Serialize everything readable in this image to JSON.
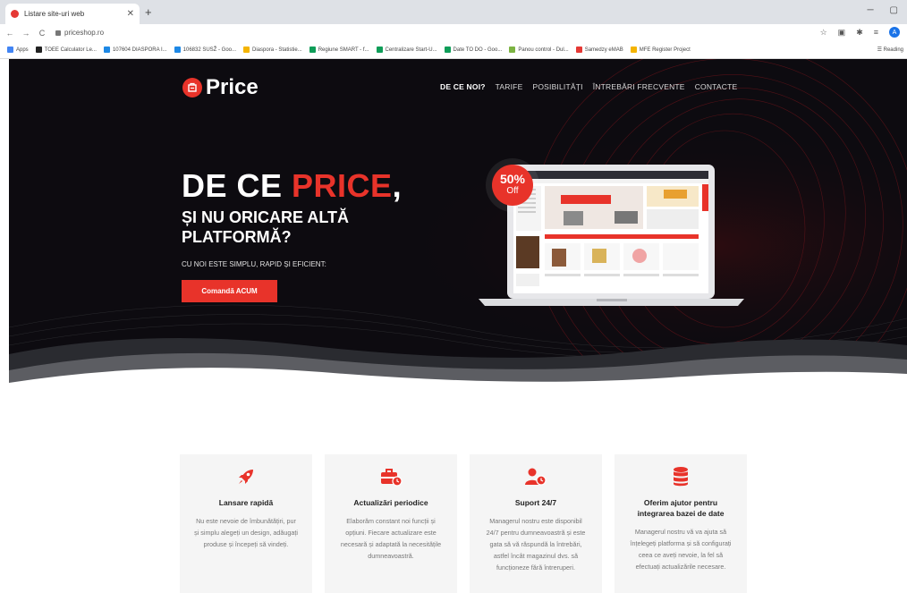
{
  "browser": {
    "tab_title": "Listare site-uri web",
    "url": "priceshop.ro",
    "profile_initial": "A",
    "bookmarks": [
      {
        "label": "Apps",
        "color": "#4285f4"
      },
      {
        "label": "TOEE Calculator Le...",
        "color": "#222222"
      },
      {
        "label": "107604 DIASPORA I...",
        "color": "#1e88e5"
      },
      {
        "label": "106832 SUSŽ - Goo...",
        "color": "#1e88e5"
      },
      {
        "label": "Diaspora - Statistie...",
        "color": "#f4b400"
      },
      {
        "label": "Regiune SMART - f...",
        "color": "#0f9d58"
      },
      {
        "label": "Centralizare Start-U...",
        "color": "#0f9d58"
      },
      {
        "label": "Date TO DO - Goo...",
        "color": "#0f9d58"
      },
      {
        "label": "Panou control - Dul...",
        "color": "#7cb342"
      },
      {
        "label": "Samedzy eMAB",
        "color": "#e53935"
      },
      {
        "label": "MFE Register Project",
        "color": "#f4b400"
      }
    ],
    "reading_list": "Reading"
  },
  "site": {
    "logo_text": "Price",
    "menu": [
      "DE CE NOI?",
      "TARIFE",
      "POSIBILITĂȚI",
      "ÎNTREBĂRI FRECVENTE",
      "CONTACTE"
    ],
    "hero": {
      "title_white": "DE CE ",
      "title_red": "PRICE",
      "title_comma": ",",
      "subtitle": "ȘI NU ORICARE ALTĂ PLATFORMĂ?",
      "tagline": "CU NOI ESTE SIMPLU, RAPID ȘI EFICIENT:",
      "cta": "Comandă ACUM",
      "badge_percent": "50%",
      "badge_off": "Off"
    },
    "features": [
      {
        "icon": "rocket-icon",
        "title": "Lansare rapidă",
        "text": "Nu este nevoie de îmbunătățiri, pur și simplu alegeți un design, adăugați produse și începeți să vindeți."
      },
      {
        "icon": "toolbox-icon",
        "title": "Actualizări periodice",
        "text": "Elaborăm constant noi funcții și opțiuni. Fiecare actualizare este necesară și adaptată la necesitățile dumneavoastră."
      },
      {
        "icon": "support-icon",
        "title": "Suport 24/7",
        "text": "Managerul nostru este disponibil 24/7 pentru dumneavoastră și este gata să vă răspundă la întrebări, astfel încât magazinul dvs. să funcționeze fără întreruperi."
      },
      {
        "icon": "database-icon",
        "title": "Oferim ajutor pentru integrarea bazei de date",
        "text": "Managerul nostru vă va ajuta să înțelegeți platforma și să configurați ceea ce aveți nevoie, la fel să efectuați actualizările necesare."
      }
    ]
  },
  "colors": {
    "accent": "#e8332a",
    "hero_bg": "#0d0b10"
  }
}
